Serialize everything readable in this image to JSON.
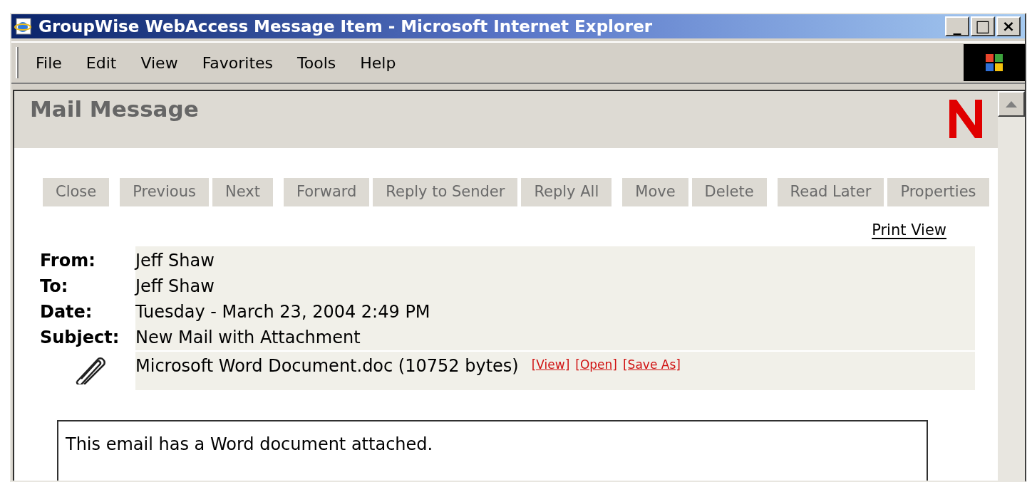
{
  "window": {
    "title": "GroupWise WebAccess Message Item - Microsoft Internet Explorer",
    "controls": [
      "_",
      "□",
      "×"
    ]
  },
  "menu": [
    "File",
    "Edit",
    "View",
    "Favorites",
    "Tools",
    "Help"
  ],
  "header": {
    "title": "Mail Message"
  },
  "toolbar": [
    [
      "Close"
    ],
    [
      "Previous",
      "Next"
    ],
    [
      "Forward",
      "Reply to Sender",
      "Reply All"
    ],
    [
      "Move",
      "Delete"
    ],
    [
      "Read Later",
      "Properties"
    ]
  ],
  "print_view": "Print View",
  "fields": [
    {
      "label": "From:",
      "value": "Jeff Shaw"
    },
    {
      "label": "To:",
      "value": "Jeff Shaw"
    },
    {
      "label": "Date:",
      "value": "Tuesday - March 23, 2004 2:49 PM"
    },
    {
      "label": "Subject:",
      "value": "New Mail with Attachment"
    }
  ],
  "attachment": {
    "name": "Microsoft Word Document.doc (10752 bytes)",
    "links": [
      "[View]",
      "[Open]",
      "[Save As]"
    ]
  },
  "body": "This email has a Word document attached."
}
